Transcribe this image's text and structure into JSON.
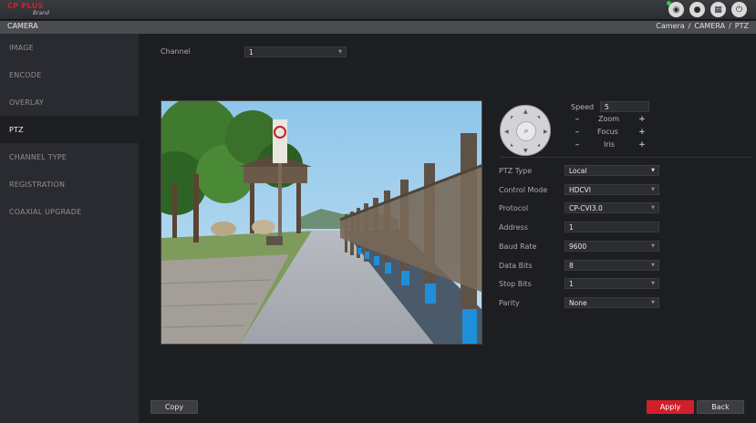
{
  "brand": {
    "name": "CP PLUS",
    "tagline": "Brand"
  },
  "top_icons": [
    "eye-icon",
    "user-icon",
    "grid-icon",
    "power-icon"
  ],
  "header": {
    "title": "CAMERA",
    "breadcrumb": [
      "Camera",
      "/",
      "CAMERA",
      "/",
      "PTZ"
    ]
  },
  "sidebar": {
    "items": [
      {
        "label": "IMAGE",
        "active": false
      },
      {
        "label": "ENCODE",
        "active": false
      },
      {
        "label": "OVERLAY",
        "active": false
      },
      {
        "label": "PTZ",
        "active": true
      },
      {
        "label": "CHANNEL TYPE",
        "active": false
      },
      {
        "label": "REGISTRATION",
        "active": false
      },
      {
        "label": "COAXIAL UPGRADE",
        "active": false
      }
    ]
  },
  "channel": {
    "label": "Channel",
    "value": "1"
  },
  "ptz_control": {
    "speed_label": "Speed",
    "speed_value": "5",
    "zoom_label": "Zoom",
    "focus_label": "Focus",
    "iris_label": "Iris",
    "minus": "–",
    "plus": "+"
  },
  "form": {
    "ptz_type": {
      "label": "PTZ Type",
      "value": "Local"
    },
    "control_mode": {
      "label": "Control Mode",
      "value": "HDCVI"
    },
    "protocol": {
      "label": "Protocol",
      "value": "CP-CVI3.0"
    },
    "address": {
      "label": "Address",
      "value": "1"
    },
    "baud_rate": {
      "label": "Baud Rate",
      "value": "9600"
    },
    "data_bits": {
      "label": "Data Bits",
      "value": "8"
    },
    "stop_bits": {
      "label": "Stop Bits",
      "value": "1"
    },
    "parity": {
      "label": "Parity",
      "value": "None"
    }
  },
  "buttons": {
    "copy": "Copy",
    "apply": "Apply",
    "back": "Back"
  },
  "colors": {
    "accent": "#d21f2c",
    "background": "#1d1e22",
    "sidebar": "#2a2b30"
  }
}
